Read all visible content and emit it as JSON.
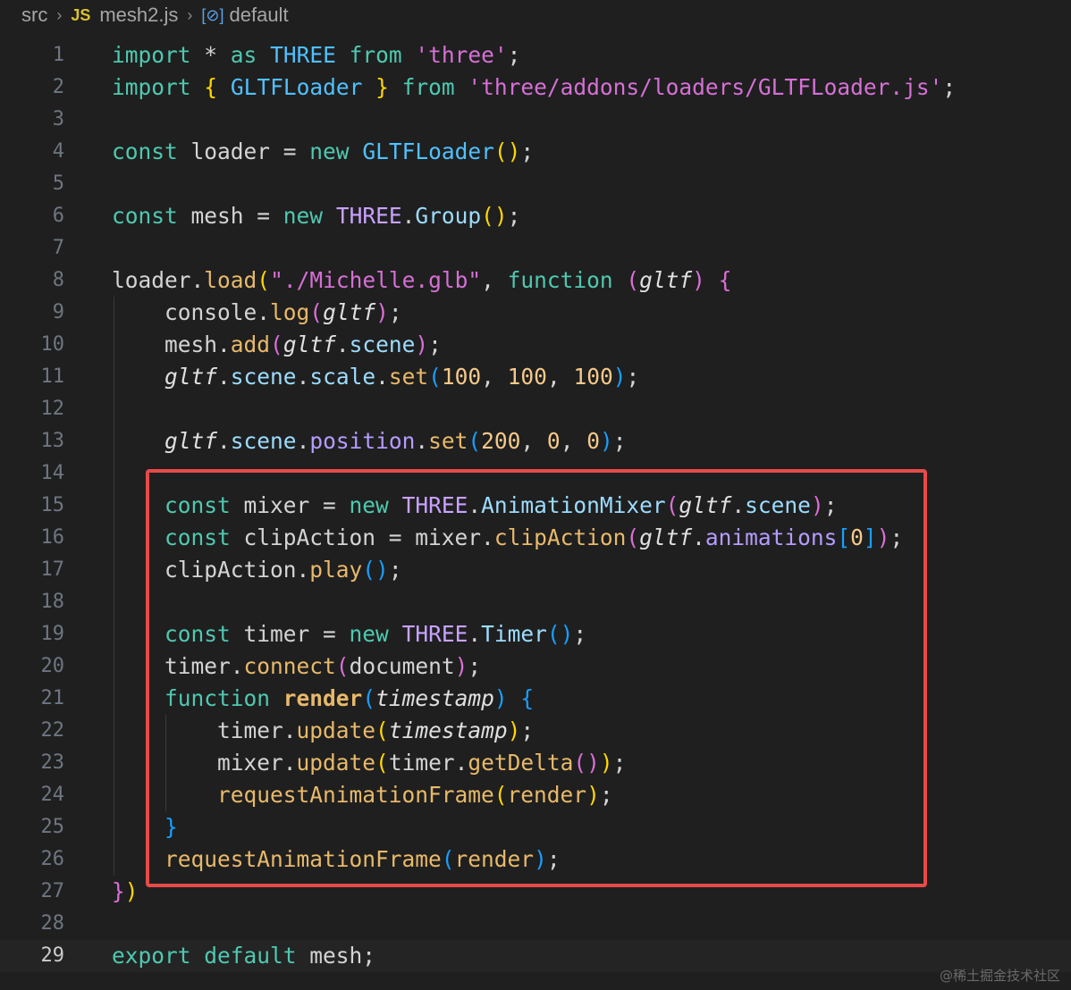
{
  "breadcrumb": {
    "folder": "src",
    "js_badge": "JS",
    "file": "mesh2.js",
    "symbol_icon": "[⊘]",
    "symbol": "default"
  },
  "active_line": 29,
  "lines": [
    {
      "n": "1",
      "tokens": [
        [
          "import",
          "kw"
        ],
        [
          " * ",
          "op"
        ],
        [
          "as",
          "kw"
        ],
        [
          " ",
          "op"
        ],
        [
          "THREE",
          "cls"
        ],
        [
          " ",
          "op"
        ],
        [
          "from",
          "kw"
        ],
        [
          " ",
          "op"
        ],
        [
          "'three'",
          "str2"
        ],
        [
          ";",
          "op"
        ]
      ]
    },
    {
      "n": "2",
      "tokens": [
        [
          "import",
          "kw"
        ],
        [
          " ",
          "op"
        ],
        [
          "{",
          "p1"
        ],
        [
          " ",
          "op"
        ],
        [
          "GLTFLoader",
          "cls"
        ],
        [
          " ",
          "op"
        ],
        [
          "}",
          "p1"
        ],
        [
          " ",
          "op"
        ],
        [
          "from",
          "kw"
        ],
        [
          " ",
          "op"
        ],
        [
          "'three/addons/loaders/GLTFLoader.js'",
          "str2"
        ],
        [
          ";",
          "op"
        ]
      ]
    },
    {
      "n": "3",
      "tokens": []
    },
    {
      "n": "4",
      "tokens": [
        [
          "const",
          "kw"
        ],
        [
          " loader = ",
          "var"
        ],
        [
          "new",
          "kw"
        ],
        [
          " ",
          "op"
        ],
        [
          "GLTFLoader",
          "cls"
        ],
        [
          "()",
          "p1"
        ],
        [
          ";",
          "op"
        ]
      ]
    },
    {
      "n": "5",
      "tokens": []
    },
    {
      "n": "6",
      "tokens": [
        [
          "const",
          "kw"
        ],
        [
          " mesh = ",
          "var"
        ],
        [
          "new",
          "kw"
        ],
        [
          " ",
          "op"
        ],
        [
          "THREE",
          "cls2"
        ],
        [
          ".",
          "op"
        ],
        [
          "Group",
          "prop"
        ],
        [
          "()",
          "p1"
        ],
        [
          ";",
          "op"
        ]
      ]
    },
    {
      "n": "7",
      "tokens": []
    },
    {
      "n": "8",
      "tokens": [
        [
          "loader",
          "var"
        ],
        [
          ".",
          "op"
        ],
        [
          "load",
          "fn2"
        ],
        [
          "(",
          "p1"
        ],
        [
          "\"./Michelle.glb\"",
          "str2"
        ],
        [
          ", ",
          "op"
        ],
        [
          "function",
          "kw"
        ],
        [
          " ",
          "op"
        ],
        [
          "(",
          "p2"
        ],
        [
          "gltf",
          "it"
        ],
        [
          ")",
          "p2"
        ],
        [
          " ",
          "op"
        ],
        [
          "{",
          "p2"
        ]
      ]
    },
    {
      "n": "9",
      "tokens": [
        [
          "    console",
          "var"
        ],
        [
          ".",
          "op"
        ],
        [
          "log",
          "fn2"
        ],
        [
          "(",
          "p2"
        ],
        [
          "gltf",
          "it"
        ],
        [
          ")",
          "p2"
        ],
        [
          ";",
          "op"
        ]
      ]
    },
    {
      "n": "10",
      "tokens": [
        [
          "    mesh",
          "var"
        ],
        [
          ".",
          "op"
        ],
        [
          "add",
          "fn2"
        ],
        [
          "(",
          "p2"
        ],
        [
          "gltf",
          "it"
        ],
        [
          ".",
          "op"
        ],
        [
          "scene",
          "prop"
        ],
        [
          ")",
          "p2"
        ],
        [
          ";",
          "op"
        ]
      ]
    },
    {
      "n": "11",
      "tokens": [
        [
          "    ",
          "op"
        ],
        [
          "gltf",
          "it"
        ],
        [
          ".",
          "op"
        ],
        [
          "scene",
          "prop"
        ],
        [
          ".",
          "op"
        ],
        [
          "scale",
          "prop"
        ],
        [
          ".",
          "op"
        ],
        [
          "set",
          "fn2"
        ],
        [
          "(",
          "p3"
        ],
        [
          "100",
          "num"
        ],
        [
          ", ",
          "op"
        ],
        [
          "100",
          "num"
        ],
        [
          ", ",
          "op"
        ],
        [
          "100",
          "num"
        ],
        [
          ")",
          "p3"
        ],
        [
          ";",
          "op"
        ]
      ]
    },
    {
      "n": "12",
      "tokens": []
    },
    {
      "n": "13",
      "tokens": [
        [
          "    ",
          "op"
        ],
        [
          "gltf",
          "it"
        ],
        [
          ".",
          "op"
        ],
        [
          "scene",
          "prop"
        ],
        [
          ".",
          "op"
        ],
        [
          "position",
          "prop2"
        ],
        [
          ".",
          "op"
        ],
        [
          "set",
          "fn2"
        ],
        [
          "(",
          "p3"
        ],
        [
          "200",
          "num"
        ],
        [
          ", ",
          "op"
        ],
        [
          "0",
          "num"
        ],
        [
          ", ",
          "op"
        ],
        [
          "0",
          "num"
        ],
        [
          ")",
          "p3"
        ],
        [
          ";",
          "op"
        ]
      ]
    },
    {
      "n": "14",
      "tokens": []
    },
    {
      "n": "15",
      "tokens": [
        [
          "    ",
          "op"
        ],
        [
          "const",
          "kw"
        ],
        [
          " mixer = ",
          "var"
        ],
        [
          "new",
          "kw"
        ],
        [
          " ",
          "op"
        ],
        [
          "THREE",
          "cls2"
        ],
        [
          ".",
          "op"
        ],
        [
          "AnimationMixer",
          "prop"
        ],
        [
          "(",
          "p2"
        ],
        [
          "gltf",
          "it"
        ],
        [
          ".",
          "op"
        ],
        [
          "scene",
          "prop"
        ],
        [
          ")",
          "p2"
        ],
        [
          ";",
          "op"
        ]
      ]
    },
    {
      "n": "16",
      "tokens": [
        [
          "    ",
          "op"
        ],
        [
          "const",
          "kw"
        ],
        [
          " clipAction = mixer",
          "var"
        ],
        [
          ".",
          "op"
        ],
        [
          "clipAction",
          "fn2"
        ],
        [
          "(",
          "p2"
        ],
        [
          "gltf",
          "it"
        ],
        [
          ".",
          "op"
        ],
        [
          "animations",
          "prop2"
        ],
        [
          "[",
          "p3"
        ],
        [
          "0",
          "num"
        ],
        [
          "]",
          "p3"
        ],
        [
          ")",
          "p2"
        ],
        [
          ";",
          "op"
        ]
      ]
    },
    {
      "n": "17",
      "tokens": [
        [
          "    clipAction",
          "var"
        ],
        [
          ".",
          "op"
        ],
        [
          "play",
          "fn2"
        ],
        [
          "()",
          "p3"
        ],
        [
          ";",
          "op"
        ]
      ]
    },
    {
      "n": "18",
      "tokens": []
    },
    {
      "n": "19",
      "tokens": [
        [
          "    ",
          "op"
        ],
        [
          "const",
          "kw"
        ],
        [
          " timer = ",
          "var"
        ],
        [
          "new",
          "kw"
        ],
        [
          " ",
          "op"
        ],
        [
          "THREE",
          "cls2"
        ],
        [
          ".",
          "op"
        ],
        [
          "Timer",
          "prop"
        ],
        [
          "()",
          "p3"
        ],
        [
          ";",
          "op"
        ]
      ]
    },
    {
      "n": "20",
      "tokens": [
        [
          "    timer",
          "var"
        ],
        [
          ".",
          "op"
        ],
        [
          "connect",
          "fn2"
        ],
        [
          "(",
          "p2"
        ],
        [
          "document",
          "var"
        ],
        [
          ")",
          "p2"
        ],
        [
          ";",
          "op"
        ]
      ]
    },
    {
      "n": "21",
      "tokens": [
        [
          "    ",
          "op"
        ],
        [
          "function",
          "kw"
        ],
        [
          " ",
          "op"
        ],
        [
          "render",
          "bold"
        ],
        [
          "(",
          "p3"
        ],
        [
          "timestamp",
          "it"
        ],
        [
          ")",
          "p3"
        ],
        [
          " ",
          "op"
        ],
        [
          "{",
          "p3"
        ]
      ]
    },
    {
      "n": "22",
      "tokens": [
        [
          "        timer",
          "var"
        ],
        [
          ".",
          "op"
        ],
        [
          "update",
          "fn2"
        ],
        [
          "(",
          "p1"
        ],
        [
          "timestamp",
          "it"
        ],
        [
          ")",
          "p1"
        ],
        [
          ";",
          "op"
        ]
      ]
    },
    {
      "n": "23",
      "tokens": [
        [
          "        mixer",
          "var"
        ],
        [
          ".",
          "op"
        ],
        [
          "update",
          "fn2"
        ],
        [
          "(",
          "p1"
        ],
        [
          "timer",
          "var"
        ],
        [
          ".",
          "op"
        ],
        [
          "getDelta",
          "fn2"
        ],
        [
          "()",
          "p2"
        ],
        [
          ")",
          "p1"
        ],
        [
          ";",
          "op"
        ]
      ]
    },
    {
      "n": "24",
      "tokens": [
        [
          "        ",
          "op"
        ],
        [
          "requestAnimationFrame",
          "fn2"
        ],
        [
          "(",
          "p1"
        ],
        [
          "render",
          "fn2"
        ],
        [
          ")",
          "p1"
        ],
        [
          ";",
          "op"
        ]
      ]
    },
    {
      "n": "25",
      "tokens": [
        [
          "    ",
          "op"
        ],
        [
          "}",
          "p3"
        ]
      ]
    },
    {
      "n": "26",
      "tokens": [
        [
          "    ",
          "op"
        ],
        [
          "requestAnimationFrame",
          "fn2"
        ],
        [
          "(",
          "p3"
        ],
        [
          "render",
          "fn2"
        ],
        [
          ")",
          "p3"
        ],
        [
          ";",
          "op"
        ]
      ]
    },
    {
      "n": "27",
      "tokens": [
        [
          "}",
          "p2"
        ],
        [
          ")",
          "p1"
        ]
      ]
    },
    {
      "n": "28",
      "tokens": []
    },
    {
      "n": "29",
      "tokens": [
        [
          "export",
          "kw"
        ],
        [
          " ",
          "op"
        ],
        [
          "default",
          "kw"
        ],
        [
          " mesh;",
          "var"
        ]
      ]
    }
  ],
  "watermark": "@稀土掘金技术社区",
  "colors": {
    "background": "#1f1f1f",
    "highlight_border": "#e84a4a"
  }
}
